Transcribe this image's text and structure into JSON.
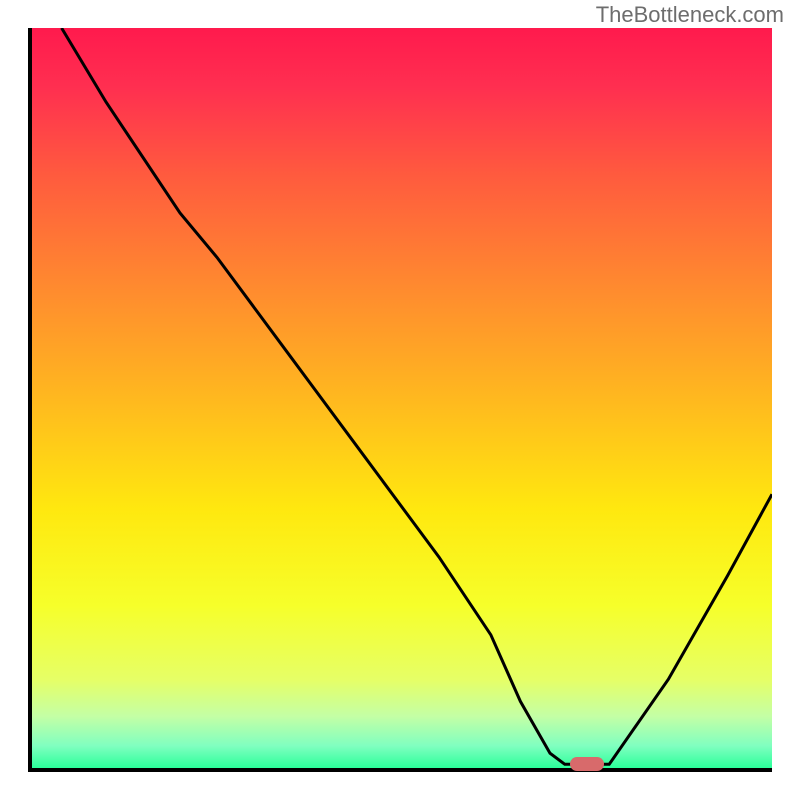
{
  "watermark": "TheBottleneck.com",
  "colors": {
    "axis": "#000000",
    "curve": "#000000",
    "marker": "#d86a6b",
    "watermark_text": "#6d6d6d",
    "gradient_stops": [
      {
        "offset": 0.0,
        "color": "#ff1a4d"
      },
      {
        "offset": 0.08,
        "color": "#ff2f50"
      },
      {
        "offset": 0.2,
        "color": "#ff5b3e"
      },
      {
        "offset": 0.35,
        "color": "#ff8a2f"
      },
      {
        "offset": 0.5,
        "color": "#ffb81f"
      },
      {
        "offset": 0.65,
        "color": "#ffe80f"
      },
      {
        "offset": 0.78,
        "color": "#f6ff2a"
      },
      {
        "offset": 0.88,
        "color": "#e6ff66"
      },
      {
        "offset": 0.93,
        "color": "#c4ffa5"
      },
      {
        "offset": 0.97,
        "color": "#80ffc0"
      },
      {
        "offset": 1.0,
        "color": "#2bff9a"
      }
    ]
  },
  "chart_data": {
    "type": "line",
    "title": "",
    "xlabel": "",
    "ylabel": "",
    "xlim": [
      0,
      100
    ],
    "ylim": [
      0,
      100
    ],
    "grid": false,
    "legend": false,
    "x": [
      4,
      10,
      20,
      25,
      35,
      45,
      55,
      62,
      66,
      70,
      72,
      78,
      86,
      94,
      100
    ],
    "values": [
      100,
      90,
      75,
      69,
      55.5,
      42,
      28.5,
      18,
      9,
      2,
      0.5,
      0.5,
      12,
      26,
      37
    ],
    "marker": {
      "x": 75,
      "y": 0.5
    },
    "notes": "Y axis: higher value = top of plot (red). Color background encodes same y scale: 0 = green (bottom), 100 = red (top). Curve is a bottleneck V-shape with minimum near x≈72–78."
  }
}
